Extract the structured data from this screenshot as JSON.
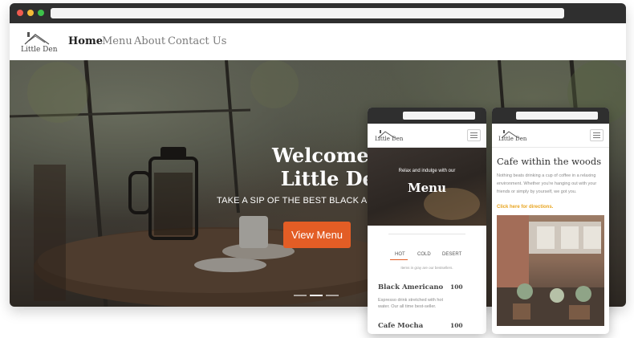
{
  "brand": {
    "name": "Little Den"
  },
  "nav": {
    "home": "Home",
    "menu": "Menu",
    "about": "About",
    "contact": "Contact Us"
  },
  "hero": {
    "title_line1": "Welcome to",
    "title_line2": "Little Den",
    "tagline": "TAKE A SIP OF THE BEST BLACK AMERICA",
    "button": "View Menu"
  },
  "mobile_menu": {
    "intro": "Relax and indulge with our",
    "title": "Menu",
    "tabs": [
      {
        "label": "HOT",
        "active": true
      },
      {
        "label": "COLD",
        "active": false
      },
      {
        "label": "DESERT",
        "active": false
      }
    ],
    "note": "Items in gray are our bestsellers.",
    "items": [
      {
        "name": "Black Americano",
        "price": "100",
        "description": "Espresso drink stretched with hot water. Our all time best-seller."
      },
      {
        "name": "Cafe Mocha",
        "price": "100"
      }
    ]
  },
  "mobile_about": {
    "title": "Cafe within the woods",
    "body": "Nothing beats drinking a cup of coffee in a relaxing environment. Whether you're hanging out with your friends or simply by yourself, we got you.",
    "link": "Click here for directions."
  },
  "colors": {
    "accent": "#e35d25",
    "link": "#e8a41f",
    "chrome": "#2f2f2f"
  },
  "icons": {
    "menu": "hamburger-icon",
    "logo": "house-roof-logo"
  }
}
